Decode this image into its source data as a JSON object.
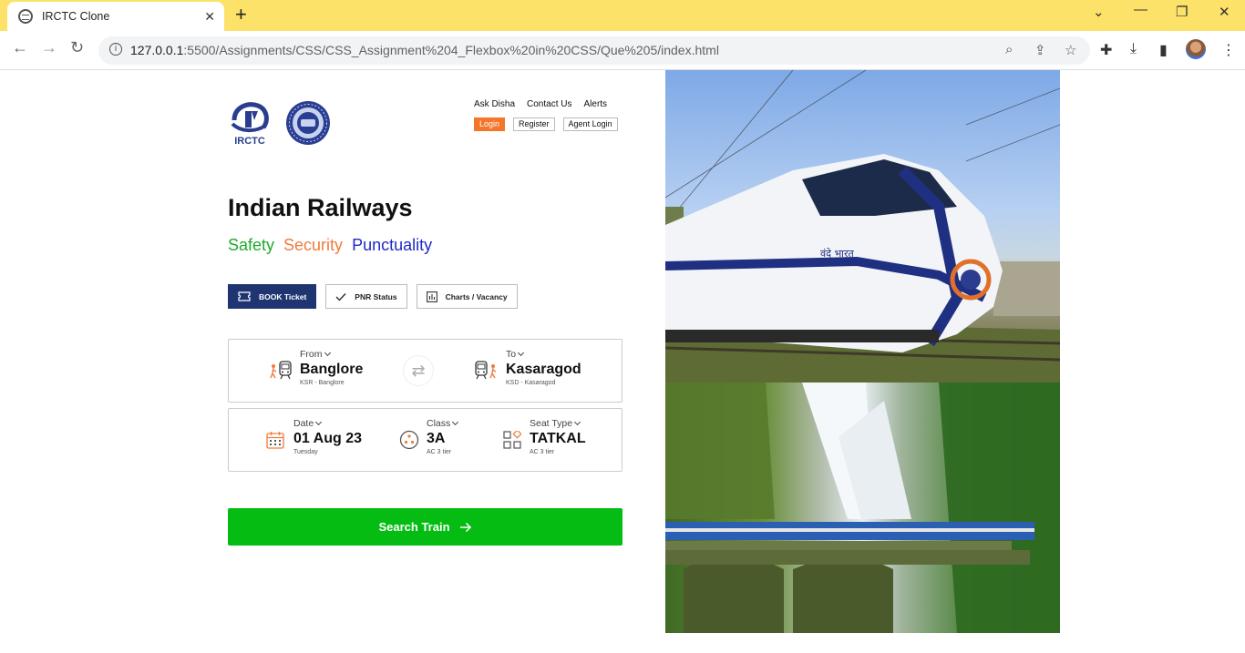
{
  "browser": {
    "tab_title": "IRCTC Clone",
    "url_host": "127.0.0.1",
    "url_path": ":5500/Assignments/CSS/CSS_Assignment%204_Flexbox%20in%20CSS/Que%205/index.html"
  },
  "header": {
    "logo_irctc_text": "IRCTC",
    "nav_links": [
      "Ask Disha",
      "Contact Us",
      "Alerts"
    ],
    "login_label": "Login",
    "register_label": "Register",
    "agent_login_label": "Agent Login"
  },
  "hero": {
    "title": "Indian Railways",
    "tag_safety": "Safety",
    "tag_security": "Security",
    "tag_punctuality": "Punctuality"
  },
  "modes": {
    "book": "BOOK Ticket",
    "pnr": "PNR Status",
    "charts": "Charts / Vacancy"
  },
  "journey": {
    "from_label": "From",
    "from_value": "Banglore",
    "from_sub": "KSR - Banglore",
    "to_label": "To",
    "to_value": "Kasaragod",
    "to_sub": "KSD - Kasaragod"
  },
  "details": {
    "date_label": "Date",
    "date_value": "01 Aug 23",
    "date_sub": "Tuesday",
    "class_label": "Class",
    "class_value": "3A",
    "class_sub": "AC 3 tier",
    "seat_label": "Seat Type",
    "seat_value": "TATKAL",
    "seat_sub": "AC 3 tier"
  },
  "search_label": "Search Train",
  "colors": {
    "chrome_yellow": "#fde26a",
    "book_active": "#1e3572",
    "login_orange": "#f4762b",
    "search_green": "#05bd12",
    "safety": "#1faa2c",
    "security": "#ef7b3e",
    "punctuality": "#2028c8"
  },
  "hero_images": {
    "top_train_text": "वंदे भारत"
  }
}
